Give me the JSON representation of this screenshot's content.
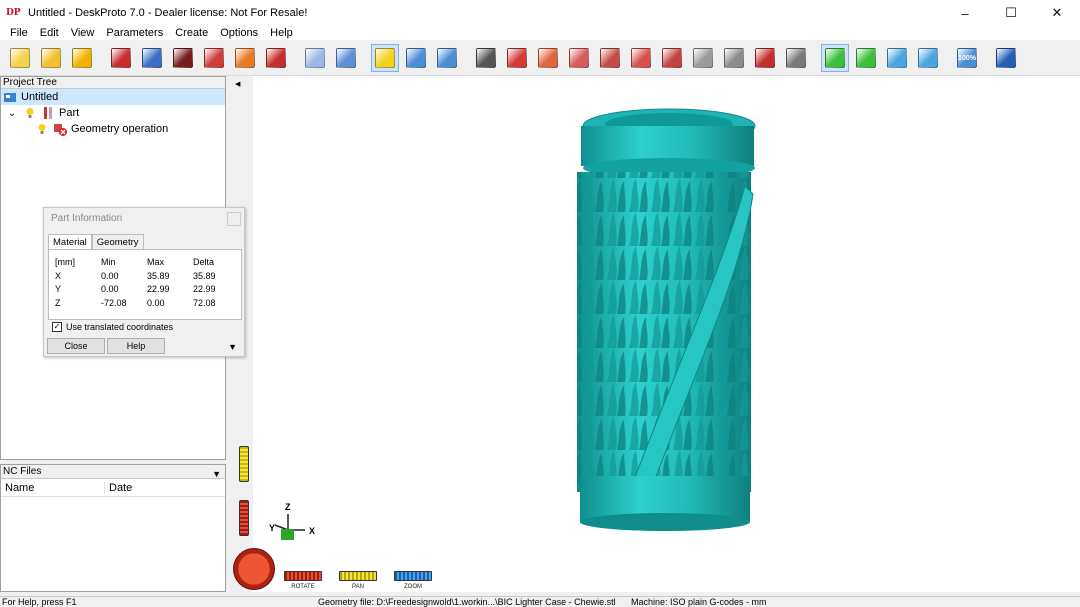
{
  "app": {
    "title": "Untitled - DeskProto 7.0 - Dealer license: Not For Resale!",
    "icon_text": "DP"
  },
  "menu": [
    "File",
    "Edit",
    "View",
    "Parameters",
    "Create",
    "Options",
    "Help"
  ],
  "toolbar": {
    "buttons": [
      {
        "name": "new-project-icon",
        "color": "#f3d34a"
      },
      {
        "name": "open-folder-icon",
        "color": "#f2c12e"
      },
      {
        "name": "save-icon",
        "color": "#f0b400"
      },
      {
        "name": "new-part-icon",
        "color": "#c62d2d"
      },
      {
        "name": "add-operation-icon",
        "color": "#3b6fc6"
      },
      {
        "name": "vector-operation-icon",
        "color": "#7a1d1d"
      },
      {
        "name": "cutter-icon",
        "color": "#d23b3b"
      },
      {
        "name": "d-operation-icon",
        "color": "#e87a21"
      },
      {
        "name": "export-icon",
        "color": "#c62d2d"
      },
      {
        "name": "shape-icon",
        "color": "#9bb9e8"
      },
      {
        "name": "search-icon",
        "color": "#5d8fd6"
      },
      {
        "name": "info-icon",
        "color": "#f2d21b",
        "active": true
      },
      {
        "name": "layout-icon",
        "color": "#4a8ed8"
      },
      {
        "name": "preview-icon",
        "color": "#4a8ed8"
      },
      {
        "name": "camera-icon",
        "color": "#555555"
      },
      {
        "name": "view-front-icon",
        "color": "#d33b3b"
      },
      {
        "name": "view-back-icon",
        "color": "#e0643e"
      },
      {
        "name": "view-left-icon",
        "color": "#d95a5a"
      },
      {
        "name": "view-right-icon",
        "color": "#c74b4b"
      },
      {
        "name": "view-top-icon",
        "color": "#d85050"
      },
      {
        "name": "view-bottom-icon",
        "color": "#c44242"
      },
      {
        "name": "view-iso-icon",
        "color": "#9a9a9a"
      },
      {
        "name": "view-iso2-icon",
        "color": "#8c8c8c"
      },
      {
        "name": "render-icon",
        "color": "#c62d2d"
      },
      {
        "name": "render2-icon",
        "color": "#7a7a7a"
      },
      {
        "name": "rotate-view-icon",
        "color": "#3bbf3b",
        "active": true
      },
      {
        "name": "pan-view-icon",
        "color": "#3bbf3b"
      },
      {
        "name": "zoom-in-icon",
        "color": "#49a6e0"
      },
      {
        "name": "zoom-window-icon",
        "color": "#49a6e0"
      },
      {
        "name": "zoom-100-icon",
        "color": "#4a8ed8",
        "label": "100%"
      },
      {
        "name": "help-book-icon",
        "color": "#1f5fb8"
      }
    ]
  },
  "project_tree": {
    "header": "Project Tree",
    "items": [
      {
        "label": "Untitled",
        "level": 0,
        "selected": true
      },
      {
        "label": "Part",
        "level": 1
      },
      {
        "label": "Geometry operation",
        "level": 2
      }
    ]
  },
  "nc_files": {
    "header": "NC Files",
    "columns": [
      "Name",
      "Date"
    ]
  },
  "part_info": {
    "title": "Part Information",
    "tabs": [
      "Material",
      "Geometry"
    ],
    "headers": [
      "[mm]",
      "Min",
      "Max",
      "Delta"
    ],
    "rows": [
      [
        "X",
        "0.00",
        "35.89",
        "35.89"
      ],
      [
        "Y",
        "0.00",
        "22.99",
        "22.99"
      ],
      [
        "Z",
        "-72.08",
        "0.00",
        "72.08"
      ]
    ],
    "checkbox_label": "Use translated coordinates",
    "checkbox_checked": true,
    "close_label": "Close",
    "help_label": "Help"
  },
  "view_controls": {
    "rotate": "ROTATE",
    "pan": "PAN",
    "zoom": "ZOOM"
  },
  "axes": {
    "z": "Z",
    "y": "Y",
    "x": "X"
  },
  "status": {
    "help": "For Help, press F1",
    "geometry": "Geometry file: D:\\Freedesignwold\\1.workin...\\BIC Lighter Case - Chewie.stl",
    "machine": "Machine: ISO plain G-codes - mm"
  },
  "colors": {
    "model": "#26b8b8",
    "model_dark": "#128a8a",
    "selection": "#cce8ff"
  }
}
